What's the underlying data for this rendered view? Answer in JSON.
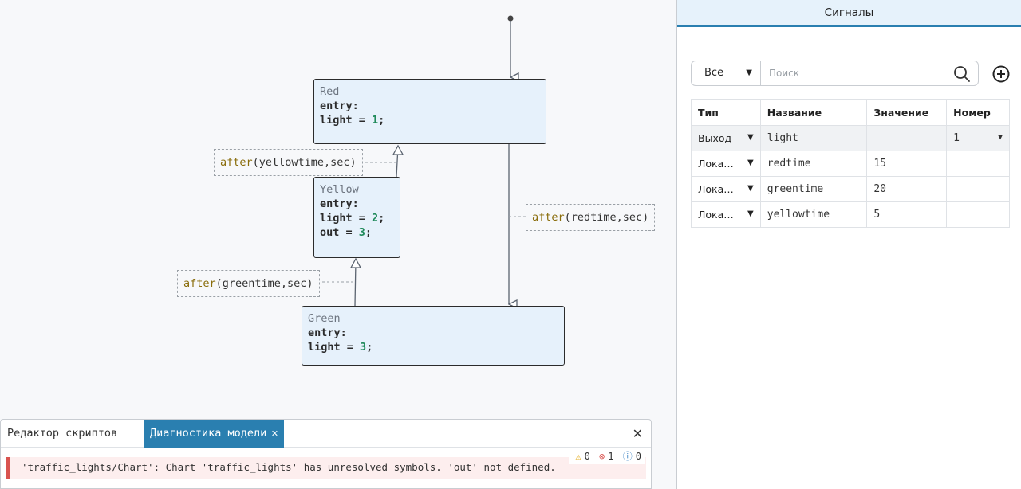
{
  "states": {
    "red": {
      "name": "Red",
      "lines": [
        [
          "entry:"
        ],
        [
          "light = ",
          "1",
          ";"
        ]
      ]
    },
    "yellow": {
      "name": "Yellow",
      "lines": [
        [
          "entry:"
        ],
        [
          "light = ",
          "2",
          ";"
        ],
        [
          "out = ",
          "3",
          ";"
        ]
      ]
    },
    "green": {
      "name": "Green",
      "lines": [
        [
          "entry:"
        ],
        [
          "light = ",
          "3",
          ";"
        ]
      ]
    }
  },
  "transitions": {
    "red_to_yellow": {
      "fn": "after",
      "args": "(yellowtime,sec)"
    },
    "red_to_green": {
      "fn": "after",
      "args": "(redtime,sec)"
    },
    "green_to_yellow": {
      "fn": "after",
      "args": "(greentime,sec)"
    }
  },
  "signals_panel": {
    "title": "Сигналы",
    "filter_value": "Все",
    "search_placeholder": "Поиск",
    "columns": [
      "Тип",
      "Название",
      "Значение",
      "Номер"
    ],
    "rows": [
      {
        "type": "Выход",
        "name": "light",
        "value": "",
        "number": "1"
      },
      {
        "type": "Локальная",
        "name": "redtime",
        "value": "15",
        "number": ""
      },
      {
        "type": "Локальная",
        "name": "greentime",
        "value": "20",
        "number": ""
      },
      {
        "type": "Локальная",
        "name": "yellowtime",
        "value": "5",
        "number": ""
      }
    ]
  },
  "dock": {
    "tabs": [
      {
        "label": "Редактор скриптов",
        "active": false
      },
      {
        "label": "Диагностика модели",
        "active": true
      }
    ],
    "counts": {
      "warnings": "0",
      "errors": "1",
      "info": "0"
    },
    "message": "'traffic_lights/Chart': Chart 'traffic_lights' has unresolved symbols. 'out' not defined."
  },
  "colors": {
    "accent": "#2a7fb0",
    "state_fill": "#e6f1fb",
    "error": "#d9534f"
  }
}
